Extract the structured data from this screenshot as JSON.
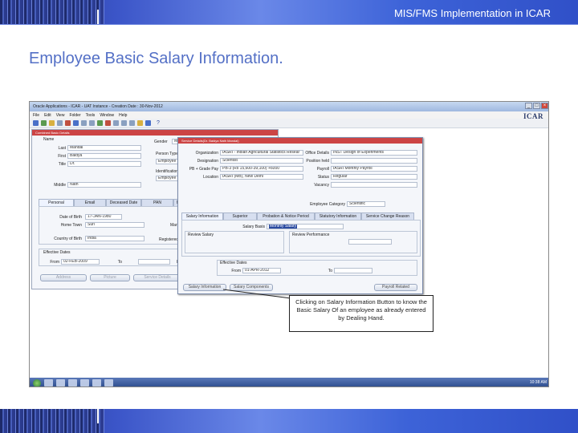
{
  "header": {
    "banner_title": "MIS/FMS Implementation in ICAR",
    "page_title": "Employee Basic Salary Information."
  },
  "screenshot": {
    "window_title": "Oracle Applications - ICAR - UAT Instance - Creation Date : 30-Nov-2012",
    "menu": [
      "File",
      "Edit",
      "View",
      "Folder",
      "Tools",
      "Window",
      "Help"
    ],
    "logo": "ICAR",
    "employee_form": {
      "title": "Combined Basic Details",
      "name_label": "Name",
      "last_label": "Last",
      "last_value": "Mandal",
      "first_label": "First",
      "first_value": "Baidya",
      "title_label": "Title",
      "title_value": "Dr.",
      "middle_label": "Middle",
      "middle_value": "Nath",
      "gender_label": "Gender",
      "gender_value": "Male",
      "person_type_label": "Person Type",
      "person_type_value": "Employee",
      "identification_label": "Identification",
      "identification_value": "Employee",
      "tabs": [
        "Personal",
        "Email",
        "Deceased Date",
        "PAN",
        "Be"
      ],
      "dob_label": "Date of Birth",
      "dob_value": "17-JAN-1980",
      "home_town_label": "Home Town",
      "home_town_value": "Suri",
      "country_label": "Country of Birth",
      "country_value": "India",
      "mari_label": "Mari",
      "n_label": "N",
      "registered_label": "Registered",
      "effective_dates_label": "Effective Dates",
      "from_label": "From",
      "from_value": "02-FEB-2009",
      "to_label": "To",
      "e_label": "E",
      "buttons": [
        "Address",
        "Picture",
        "Service Details"
      ]
    },
    "service_dialog": {
      "title": "Service Details(Dr. Baidya Nath Mandal)",
      "organization_label": "Organization",
      "organization_value": "IASRI - Indian Agricultural Statistics Resear",
      "designation_label": "Designation",
      "designation_value": "Scientist",
      "pb_label": "PB + Grade Pay",
      "pb_value": "PB-3 (Rs 15,600-39,100) +6000",
      "location_label": "Location",
      "location_value": "IASRI (MB), New Delhi",
      "office_details_label": "Office Details",
      "office_details_value": "INST Design of Experiments",
      "position_held_label": "Position held",
      "payroll_label": "Payroll",
      "payroll_value": "IASRI Monthly Payroll",
      "status_label": "Status",
      "status_value": "Regular",
      "vacancy_label": "Vacancy",
      "employee_category_label": "Employee Category",
      "employee_category_value": "Scientific",
      "tabs": [
        "Salary Information",
        "Superior",
        "Probation & Notice Period",
        "Statutory Information",
        "Service Change Reason"
      ],
      "salary_basis_label": "Salary Basis",
      "salary_basis_value": "Monthly Salary",
      "review_salary_label": "Review Salary",
      "review_performance_label": "Review Performance",
      "effective_dates_label": "Effective Dates",
      "from_label": "From",
      "from_value": "01-APR-2012",
      "to_label": "To",
      "buttons": {
        "salary_information": "Salary Information",
        "salary_components": "Salary Components",
        "payroll_related": "Payroll Related"
      }
    },
    "callout": "Clicking on Salary Information Button to know the Basic Salary Of an employee as already entered by Dealing Hand.",
    "tray_time": "10:38 AM"
  },
  "colors": {
    "title_blue": "#5470c6",
    "banner_blue": "#3b55c8"
  }
}
